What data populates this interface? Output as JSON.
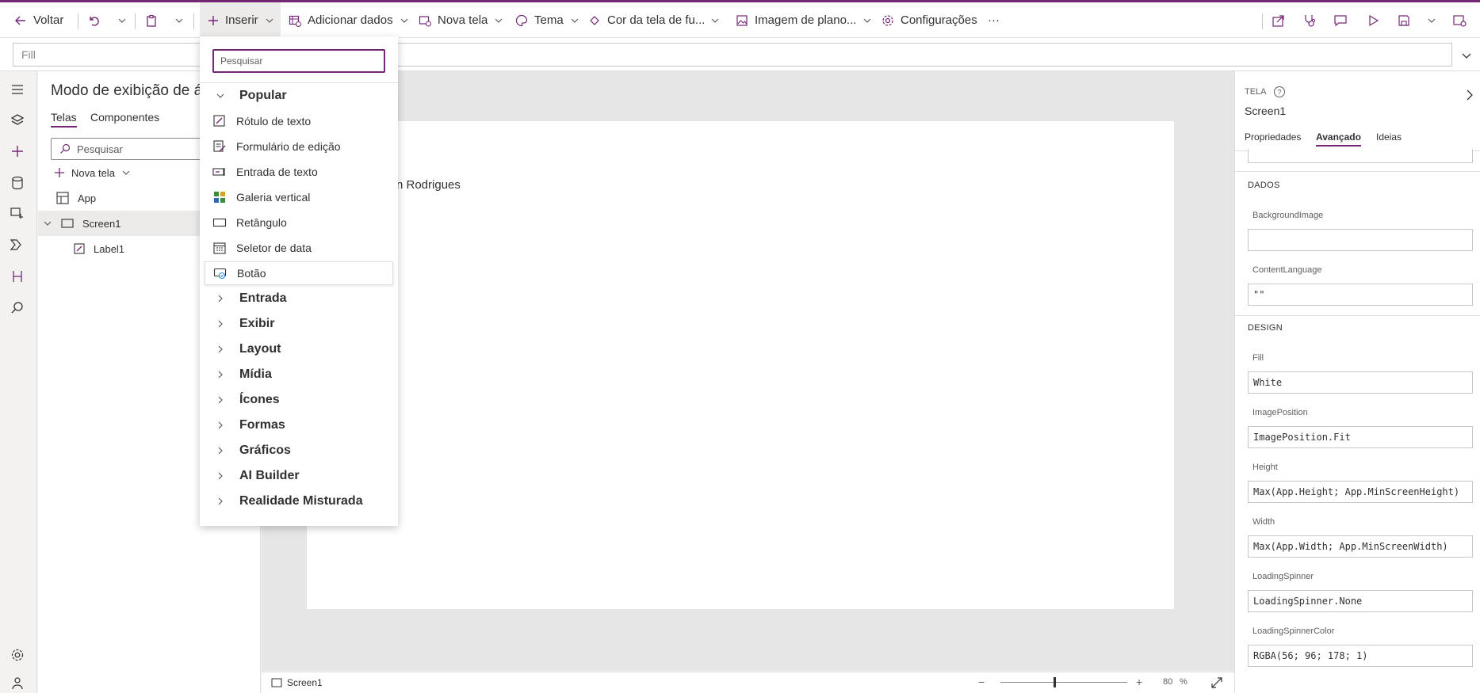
{
  "toolbar": {
    "back": "Voltar",
    "insert": "Inserir",
    "add_data": "Adicionar dados",
    "new_screen": "Nova tela",
    "theme": "Tema",
    "background_color": "Cor da tela de fu...",
    "background_image": "Imagem de plano...",
    "settings": "Configurações",
    "more": "···"
  },
  "formula_bar": {
    "property": "Fill"
  },
  "tree_view": {
    "title": "Modo de exibição de á",
    "tabs": [
      "Telas",
      "Componentes"
    ],
    "search_placeholder": "Pesquisar",
    "new_screen": "Nova tela",
    "nodes": [
      "App",
      "Screen1",
      "Label1"
    ]
  },
  "canvas": {
    "label_text": "n Rodrigues"
  },
  "insert_menu": {
    "search_placeholder": "Pesquisar",
    "popular_heading": "Popular",
    "popular_items": [
      {
        "label": "Rótulo de texto",
        "icon": "edit-label-icon"
      },
      {
        "label": "Formulário de edição",
        "icon": "edit-form-icon"
      },
      {
        "label": "Entrada de texto",
        "icon": "text-input-icon"
      },
      {
        "label": "Galeria vertical",
        "icon": "gallery-icon"
      },
      {
        "label": "Retângulo",
        "icon": "rectangle-icon"
      },
      {
        "label": "Seletor de data",
        "icon": "calendar-icon"
      },
      {
        "label": "Botão",
        "icon": "button-icon"
      }
    ],
    "categories": [
      "Entrada",
      "Exibir",
      "Layout",
      "Mídia",
      "Ícones",
      "Formas",
      "Gráficos",
      "AI Builder",
      "Realidade Misturada"
    ]
  },
  "properties": {
    "type_label": "TELA",
    "screen_name": "Screen1",
    "tabs": [
      "Propriedades",
      "Avançado",
      "Ideias"
    ],
    "active_tab": "Avançado",
    "data_section": "DADOS",
    "design_section": "DESIGN",
    "data_props": [
      {
        "name": "BackgroundImage",
        "value": ""
      },
      {
        "name": "ContentLanguage",
        "value": "\"\""
      }
    ],
    "design_props": [
      {
        "name": "Fill",
        "value": "White"
      },
      {
        "name": "ImagePosition",
        "value": "ImagePosition.Fit"
      },
      {
        "name": "Height",
        "value": "Max(App.Height; App.MinScreenHeight)"
      },
      {
        "name": "Width",
        "value": "Max(App.Width; App.MinScreenWidth)"
      },
      {
        "name": "LoadingSpinner",
        "value": "LoadingSpinner.None"
      },
      {
        "name": "LoadingSpinnerColor",
        "value": "RGBA(56; 96; 178; 1)"
      }
    ]
  },
  "status_bar": {
    "screen": "Screen1",
    "zoom": "80",
    "zoom_unit": "%",
    "zoom_minus": "−",
    "zoom_plus": "+"
  },
  "colors": {
    "accent": "#742774",
    "zoom_level_fraction": 0.42
  }
}
